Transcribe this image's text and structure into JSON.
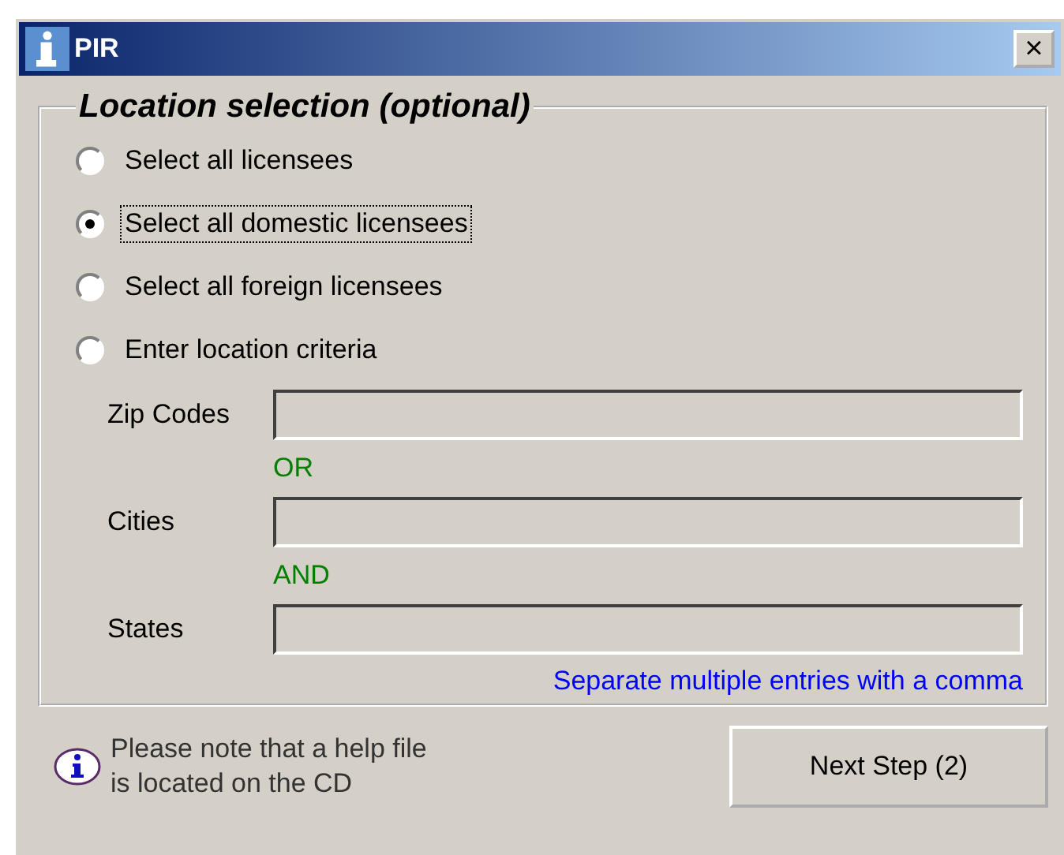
{
  "window": {
    "title": "PIR",
    "close": "×"
  },
  "group": {
    "title": "Location selection (optional)",
    "options": [
      {
        "label": "Select all licensees",
        "selected": false
      },
      {
        "label": "Select all domestic licensees",
        "selected": true
      },
      {
        "label": "Select all foreign licensees",
        "selected": false
      },
      {
        "label": "Enter location criteria",
        "selected": false
      }
    ],
    "fields": [
      {
        "label": "Zip Codes",
        "connector": "OR"
      },
      {
        "label": "Cities",
        "connector": "AND"
      },
      {
        "label": "States"
      }
    ],
    "hint": "Separate multiple entries with a comma"
  },
  "note": "Please note that a help file\nis located on the CD",
  "button": "Next Step (2)"
}
